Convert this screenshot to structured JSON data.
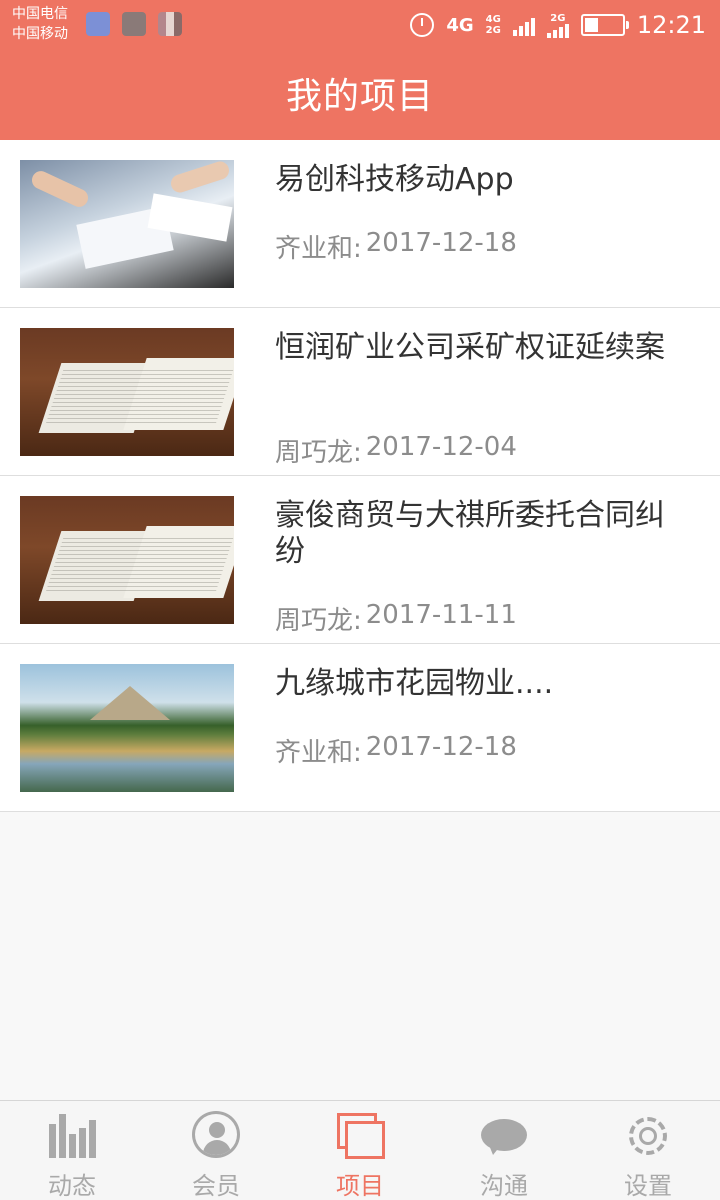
{
  "status_bar": {
    "carrier_1": "中国电信",
    "carrier_2": "中国移动",
    "network": "4G",
    "network_top": "4G",
    "network_bottom": "2G",
    "network_2": "2G",
    "time": "12:21",
    "icons": [
      "health-app-icon",
      "gallery-app-icon",
      "photo-app-icon",
      "alarm-icon",
      "signal-icon",
      "battery-icon"
    ]
  },
  "header": {
    "title": "我的项目"
  },
  "projects": [
    {
      "title": "易创科技移动App",
      "author": "齐业和:",
      "date": "2017-12-18",
      "thumbnail": "office-meeting-image"
    },
    {
      "title": "恒润矿业公司采矿权证延续案",
      "author": "周巧龙:",
      "date": "2017-12-04",
      "thumbnail": "open-book-image"
    },
    {
      "title": "豪俊商贸与大祺所委托合同纠纷",
      "author": "周巧龙:",
      "date": "2017-11-11",
      "thumbnail": "open-book-image"
    },
    {
      "title": "九缘城市花园物业....",
      "author": "齐业和:",
      "date": "2017-12-18",
      "thumbnail": "lake-landscape-image"
    }
  ],
  "tabs": [
    {
      "label": "动态",
      "icon": "bar-chart-icon",
      "active": false
    },
    {
      "label": "会员",
      "icon": "member-icon",
      "active": false
    },
    {
      "label": "项目",
      "icon": "project-icon",
      "active": true
    },
    {
      "label": "沟通",
      "icon": "chat-icon",
      "active": false
    },
    {
      "label": "设置",
      "icon": "gear-icon",
      "active": false
    }
  ],
  "colors": {
    "accent": "#ee7462",
    "inactive": "#a9a9a9",
    "title_text": "#333333",
    "meta_text": "#8c8c8c"
  }
}
